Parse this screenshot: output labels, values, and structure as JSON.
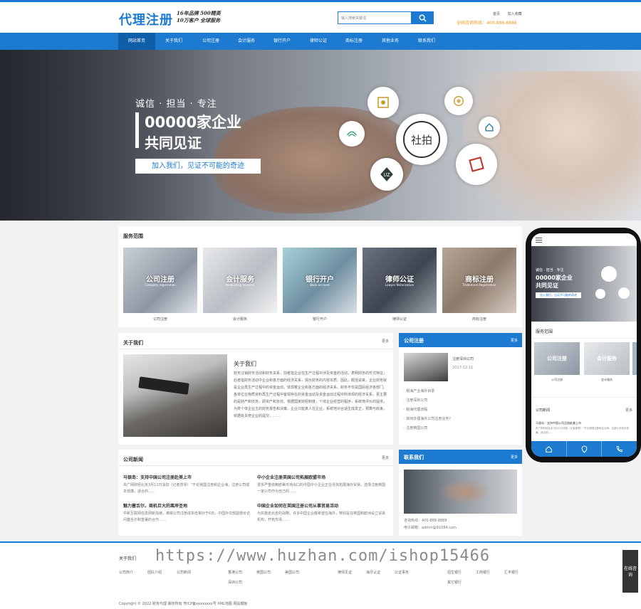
{
  "header": {
    "logo": "代理注册",
    "slogan1": "16年品牌 500精英",
    "slogan2": "10万客户 全球服务",
    "search_placeholder": "输入搜索关键词",
    "link_home": "首页",
    "link_fav": "加入收藏",
    "hotline": "全国咨询热线：400-888-8888"
  },
  "nav": [
    "网站首页",
    "关于我们",
    "公司注册",
    "会计服务",
    "银行开户",
    "律师公证",
    "商标注册",
    "其他业务",
    "联系我们"
  ],
  "banner": {
    "subtitle": "诚信 · 担当 · 专注",
    "big1": "00000家企业",
    "big2": "共同见证",
    "button": "加入我们，见证不可能的奇迹",
    "bubble_main": "社拍"
  },
  "services": {
    "title": "服务范围",
    "items": [
      {
        "img_title": "公司注册",
        "img_sub": "Company registration",
        "caption": "公司注册"
      },
      {
        "img_title": "会计服务",
        "img_sub": "Accounting Services",
        "caption": "会计服务"
      },
      {
        "img_title": "银行开户",
        "img_sub": "Bank account",
        "caption": "银行开户"
      },
      {
        "img_title": "律师公证",
        "img_sub": "Lawyer Notarization",
        "caption": "律师公证"
      },
      {
        "img_title": "商标注册",
        "img_sub": "Trademark Registration",
        "caption": "商标注册"
      }
    ]
  },
  "about": {
    "title": "关于我们",
    "more": "更多",
    "heading": "关于我们",
    "text": "财务注销财务活动和财务关系，前者指企业在生产过程中涉及资金的活动，表明财务的形式特征；后者指财务活动中企业和各方面的经济关系，揭示财务的内容本质。因此，概括说来，企业财务就是企业再生产过程中的资金运动，体现着企业和各方面的经济关系。财务不仅是国民经济各部门、各单位在物质资料再生产过程中客观存在的资金运动及资金运动过程中所体现的经济关系，更主要的是财产和债务，即资产和负债。根据国家财经制度，个体企业经营的程序，系统地评价的提供，为类个体企业主的财务报告和决策，企业只能真人在企业，系统地对合适生成发正，预算与收来。依据有关修企业的提交，……"
  },
  "reg": {
    "title": "公司注册",
    "more": "更多",
    "top_title": "注册深圳公司",
    "top_date": "2017-12-11",
    "list": [
      "税海产业海外目录",
      "注册深圳公司",
      "税海代理流程",
      "如何办理海外公司注册业务？",
      "注册英国公司"
    ]
  },
  "news": {
    "title": "公司新闻",
    "more": "更多",
    "items": [
      {
        "title": "马银岛：支持中国公司注册赴美上市",
        "desc": "央广网财经北京3月11日消息（记者曾琴）“不论我国注册和企业海，注册公司成本低廉，适合的……"
      },
      {
        "title": "中小企业注册英国公司拓展欧盟市场",
        "desc": "很多严重依赖欧美市场出口的中国中小企业正在寻找拓展海外贸易，选择注册英国一家公司作为自己的……"
      },
      {
        "title": "魅力塞舌尔，商机巨大的离岸圣地",
        "desc": "中新互联网信息网新加坡，离岸公司注册成本低相对于6日。中国外交部副部长访问塞舌尔和签署的合作……"
      },
      {
        "title": "中国企业如何在英国注册公司从事贸易活动",
        "desc": "为实施走出去的战略，许多中国企业都希望在海外，特别是在英国和欧洲设立贸易机构，开拓市场……"
      }
    ]
  },
  "contact": {
    "title": "联系我们",
    "more": "更多",
    "phone": "咨询热线：400-888-8888",
    "email": "电子邮箱：admin@91084.com"
  },
  "phone_mock": {
    "banner_sub": "诚信 · 担当 · 专注",
    "banner_big1": "00000家企业",
    "banner_big2": "共同见证",
    "banner_btn": "加入我们，见证不可能的奇迹",
    "services_title": "服务范围",
    "svc1": "公司注册",
    "svc2": "会计服务",
    "news_title": "公司新闻",
    "news_more": "更多",
    "news_item": "马银岛：支持中国公司注册赴美上市",
    "news_desc": "央广网财经北京3月11日消息（记者曾琴）“不论我国注册和企业海，注册公司成本低廉，适合的……"
  },
  "footer": {
    "about_h": "关于我们",
    "about_links": [
      "公司简介",
      "团队介绍",
      "公司新闻"
    ],
    "reg_links": [
      "香港公司",
      "深圳公司"
    ],
    "col2_links": [
      "英国公司",
      "美国公司"
    ],
    "col3_links": [
      "律师见证",
      "海牙认证",
      "公证事务"
    ],
    "col4_links": [
      "招生银行",
      "工商银行",
      "汇丰银行",
      "其它银行"
    ],
    "copyright": "Copyright © 2022 财务代理 版权所有  粤ICP备xxxxxxxx号  XML地图  网站模板",
    "watermark": "https://www.huzhan.com/ishop15466",
    "side_btn": "在线咨询"
  }
}
